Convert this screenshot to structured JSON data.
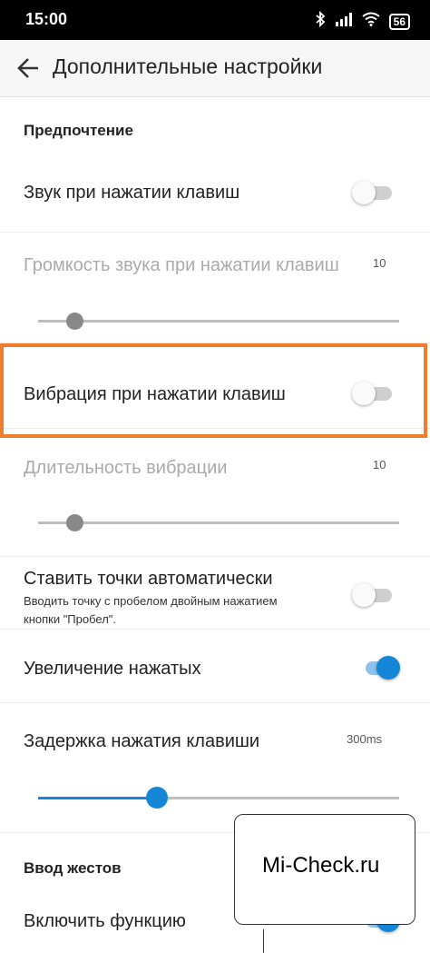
{
  "status_bar": {
    "time": "15:00",
    "bluetooth_icon": "bluetooth-icon",
    "signal_icon": "signal-icon",
    "wifi_icon": "wifi-icon",
    "battery": "56"
  },
  "app_bar": {
    "back_icon": "arrow-left-icon",
    "title": "Дополнительные настройки"
  },
  "preferences": {
    "section_title": "Предпочтение",
    "key_sound": {
      "label": "Звук при нажатии клавиш",
      "enabled": false
    },
    "key_sound_volume": {
      "label": "Громкость звука при нажатии клавиш",
      "value": "10",
      "level": 0.1
    },
    "key_vibration": {
      "label": "Вибрация при нажатии клавиш",
      "enabled": false
    },
    "vibration_duration": {
      "label": "Длительность вибрации",
      "value": "10",
      "level": 0.1
    },
    "auto_period": {
      "label": "Ставить точки автоматически",
      "description_line1": "Вводить точку с пробелом двойным нажатием",
      "description_line2": "кнопки \"Пробел\".",
      "enabled": false
    },
    "key_popup": {
      "label": "Увеличение нажатых",
      "enabled": true
    },
    "long_press_delay": {
      "label": "Задержка нажатия клавиши",
      "value": "300ms",
      "level": 0.33
    }
  },
  "gesture_input": {
    "section_title": "Ввод жестов",
    "enable_feature": {
      "label": "Включить функцию",
      "enabled": true
    }
  },
  "watermark": {
    "text": "Mi-Check.ru"
  },
  "colors": {
    "accent": "#1585d6",
    "highlight": "#f07d2c"
  }
}
